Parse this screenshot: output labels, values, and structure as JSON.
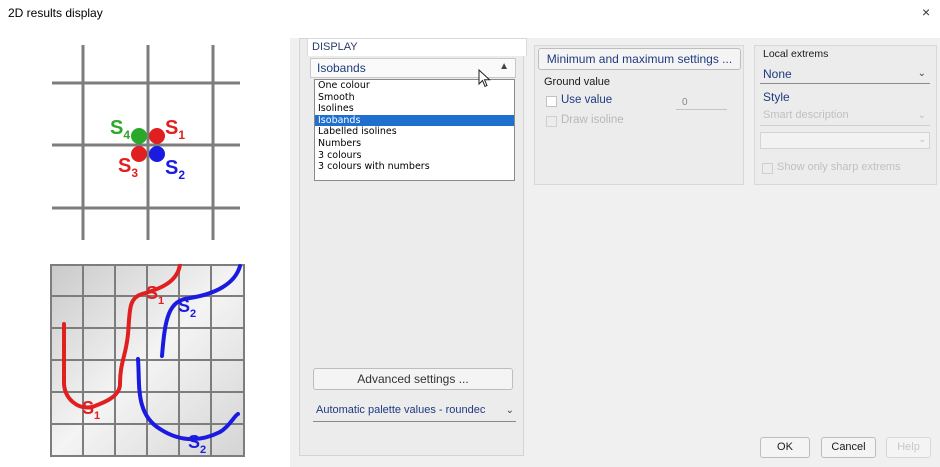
{
  "window": {
    "title": "2D results display",
    "close_glyph": "×"
  },
  "illustration": {
    "grid_points": {
      "s4": {
        "letter": "S",
        "sub": "4",
        "color": "#2aa82a"
      },
      "s1": {
        "letter": "S",
        "sub": "1",
        "color": "#e02020"
      },
      "s3": {
        "letter": "S",
        "sub": "3",
        "color": "#e02020"
      },
      "s2": {
        "letter": "S",
        "sub": "2",
        "color": "#1a1ae0"
      }
    },
    "curves": {
      "s1_upper": {
        "letter": "S",
        "sub": "1",
        "color": "#e02020"
      },
      "s2_upper": {
        "letter": "S",
        "sub": "2",
        "color": "#1a1ae0"
      },
      "s1_lower": {
        "letter": "S",
        "sub": "1",
        "color": "#e02020"
      },
      "s2_lower": {
        "letter": "S",
        "sub": "2",
        "color": "#1a1ae0"
      }
    }
  },
  "display": {
    "tab_label": "DISPLAY",
    "mode_selected": "Isobands",
    "mode_options": [
      "One colour",
      "Smooth",
      "Isolines",
      "Isobands",
      "Labelled isolines",
      "Numbers",
      "3 colours",
      "3 colours with numbers"
    ],
    "advanced_label": "Advanced settings ...",
    "palette_value": "Automatic palette values - roundec"
  },
  "values": {
    "minmax_label": "Minimum and maximum settings ...",
    "ground_label": "Ground value",
    "use_value_label": "Use value",
    "ground_value": "0",
    "draw_isoline_label": "Draw isoline"
  },
  "extremes": {
    "label": "Local extrems",
    "selected": "None",
    "style_label": "Style",
    "style_value": "Smart description",
    "sharp_label": "Show only sharp extrems"
  },
  "buttons": {
    "ok": "OK",
    "cancel": "Cancel",
    "help": "Help"
  },
  "icons": {
    "close": "close-icon",
    "arrow_up": "chevron-up-icon",
    "arrow_down": "chevron-down-icon",
    "pointer": "mouse-pointer-icon"
  },
  "colors": {
    "accent_text": "#1f3a80",
    "selection": "#1f6fcf"
  }
}
